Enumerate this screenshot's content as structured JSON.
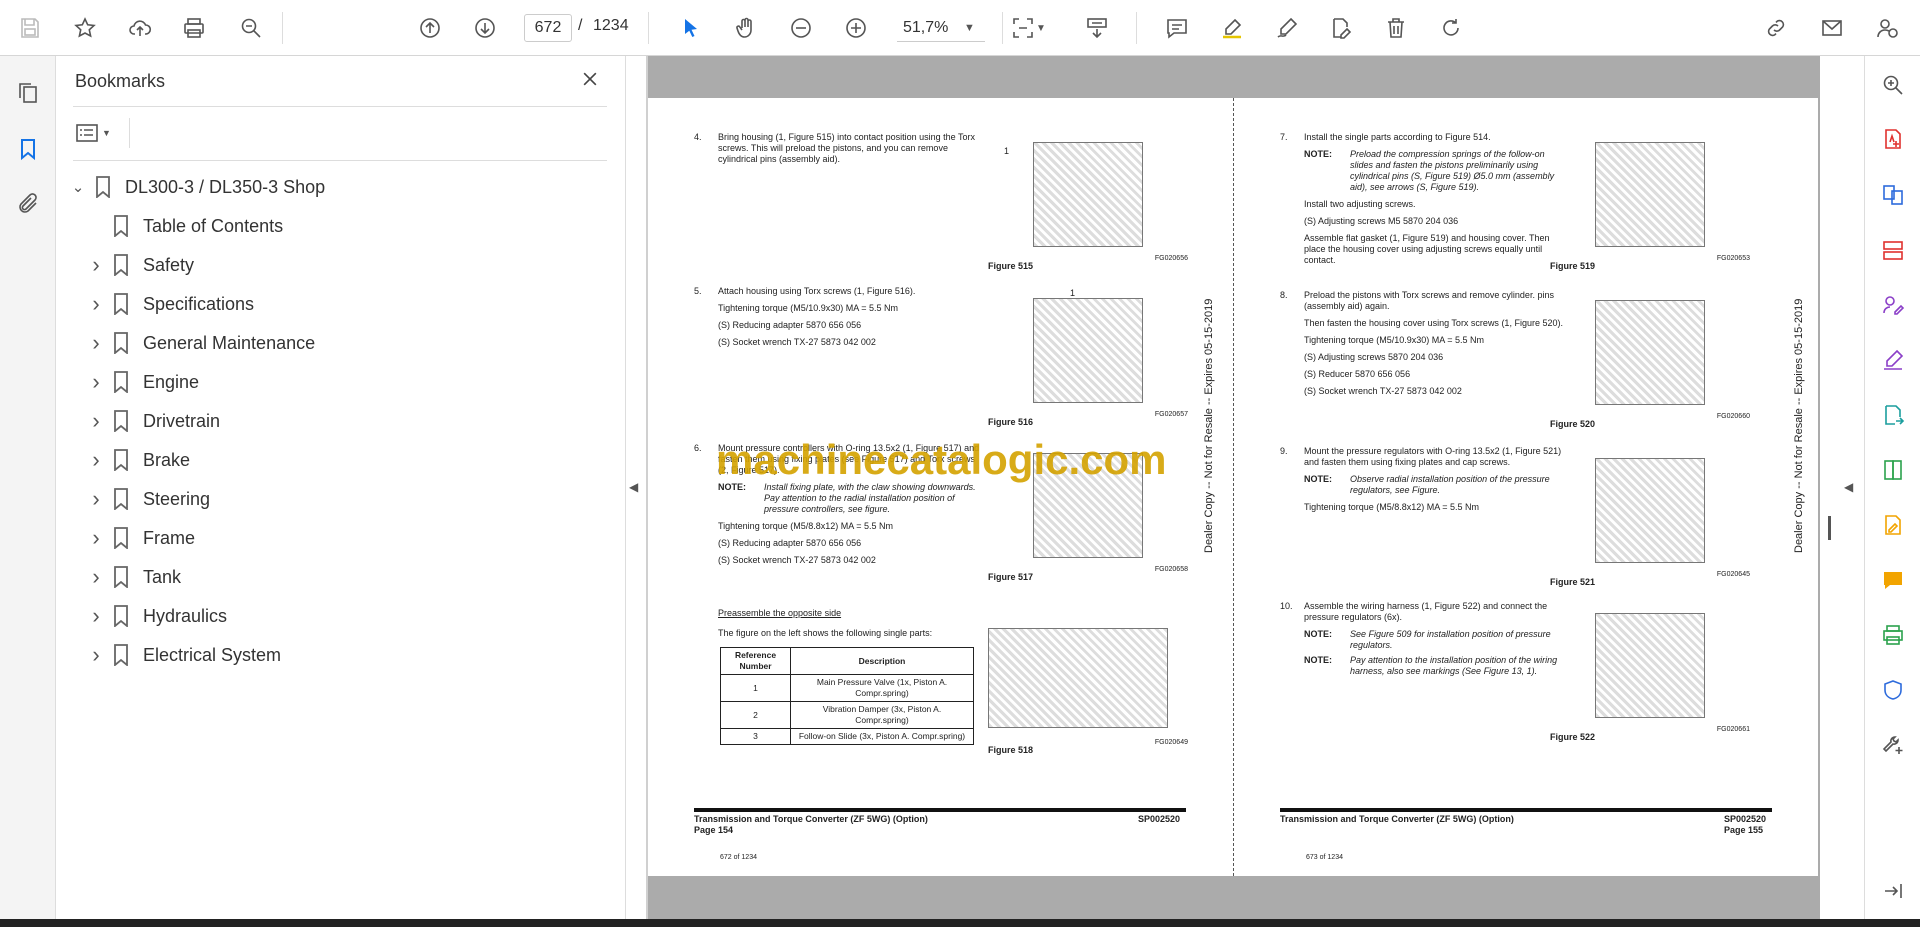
{
  "toolbar": {
    "page_current": "672",
    "page_sep": "/",
    "page_total": "1234",
    "zoom": "51,7%"
  },
  "bookmarks": {
    "title": "Bookmarks",
    "root": "DL300-3 / DL350-3 Shop",
    "items": [
      {
        "label": "Table of Contents",
        "expandable": false
      },
      {
        "label": "Safety",
        "expandable": true
      },
      {
        "label": "Specifications",
        "expandable": true
      },
      {
        "label": "General Maintenance",
        "expandable": true
      },
      {
        "label": "Engine",
        "expandable": true
      },
      {
        "label": "Drivetrain",
        "expandable": true
      },
      {
        "label": "Brake",
        "expandable": true
      },
      {
        "label": "Steering",
        "expandable": true
      },
      {
        "label": "Frame",
        "expandable": true
      },
      {
        "label": "Tank",
        "expandable": true
      },
      {
        "label": "Hydraulics",
        "expandable": true
      },
      {
        "label": "Electrical System",
        "expandable": true
      }
    ]
  },
  "watermark": "machinecatalogic.com",
  "left_page": {
    "step4": {
      "num": "4.",
      "text": "Bring housing (1, Figure 515) into contact position using the Torx screws. This will preload the pistons, and you can remove cylindrical pins (assembly aid)."
    },
    "fig515": {
      "caption": "Figure 515",
      "code": "FG020656",
      "label": "1"
    },
    "step5": {
      "num": "5.",
      "text": "Attach housing using Torx screws (1, Figure 516).",
      "torque": "Tightening torque (M5/10.9x30) MA = 5.5 Nm",
      "tool1": "(S) Reducing adapter 5870 656 056",
      "tool2": "(S) Socket wrench TX-27 5873 042 002"
    },
    "fig516": {
      "caption": "Figure 516",
      "code": "FG020657",
      "label": "1"
    },
    "step6": {
      "num": "6.",
      "text": "Mount pressure controllers with O-ring 13.5x2 (1, Figure 517) and fasten them using fixing plates (see Figure 517) and Torx screws (2, Figure 517).",
      "note_label": "NOTE:",
      "note1": "Install fixing plate, with the claw showing downwards.",
      "note2": "Pay attention to the radial installation position of pressure controllers, see figure.",
      "torque": "Tightening torque (M5/8.8x12) MA = 5.5 Nm",
      "tool1": "(S) Reducing adapter 5870 656 056",
      "tool2": "(S) Socket wrench TX-27 5873 042 002"
    },
    "fig517": {
      "caption": "Figure 517",
      "code": "FG020658"
    },
    "preassemble": "Preassemble the opposite side",
    "preassemble_text": "The figure on the left shows the following single parts:",
    "table": {
      "headers": [
        "Reference Number",
        "Description"
      ],
      "rows": [
        [
          "1",
          "Main Pressure Valve (1x, Piston A. Compr.spring)"
        ],
        [
          "2",
          "Vibration Damper (3x, Piston A. Compr.spring)"
        ],
        [
          "3",
          "Follow-on Slide (3x, Piston A. Compr.spring)"
        ]
      ]
    },
    "fig518": {
      "caption": "Figure 518",
      "code": "FG020649"
    },
    "footer_title": "Transmission and Torque Converter (ZF 5WG) (Option)",
    "footer_page": "Page 154",
    "footer_code": "SP002520",
    "pageof": "672 of 1234",
    "vertical": "Dealer Copy -- Not for Resale -- Expires 05-15-2019"
  },
  "right_page": {
    "step7": {
      "num": "7.",
      "text": "Install the single parts according to Figure 514.",
      "note_label": "NOTE:",
      "note": "Preload the compression springs of the follow-on slides and fasten the pistons preliminarily using cylindrical pins (S, Figure 519) Ø5.0 mm (assembly aid), see arrows (S, Figure 519).",
      "p1": "Install two adjusting screws.",
      "p2": "(S) Adjusting screws M5 5870 204 036",
      "p3": "Assemble flat gasket (1, Figure 519) and housing cover. Then place the housing cover using adjusting screws equally until contact."
    },
    "fig519": {
      "caption": "Figure 519",
      "code": "FG020653"
    },
    "step8": {
      "num": "8.",
      "text": "Preload the pistons with Torx screws and remove cylinder. pins (assembly aid) again.",
      "p1": "Then fasten the housing cover using Torx screws (1, Figure 520).",
      "torque": "Tightening torque (M5/10.9x30) MA = 5.5 Nm",
      "tool1": "(S) Adjusting screws 5870 204 036",
      "tool2": "(S) Reducer 5870 656 056",
      "tool3": "(S) Socket wrench TX-27 5873 042 002"
    },
    "fig520": {
      "caption": "Figure 520",
      "code": "FG020660"
    },
    "step9": {
      "num": "9.",
      "text": "Mount the pressure regulators with O-ring 13.5x2 (1, Figure 521) and fasten them using fixing plates and cap screws.",
      "note_label": "NOTE:",
      "note": "Observe radial installation position of the pressure regulators, see Figure.",
      "torque": "Tightening torque (M5/8.8x12) MA = 5.5 Nm"
    },
    "fig521": {
      "caption": "Figure 521",
      "code": "FG020645"
    },
    "step10": {
      "num": "10.",
      "text": "Assemble the wiring harness (1, Figure 522) and connect the pressure regulators (6x).",
      "note_label": "NOTE:",
      "note1": "See Figure 509 for installation position of pressure regulators.",
      "note2": "Pay attention to the installation position of the wiring harness, also see markings (See Figure 13, 1)."
    },
    "fig522": {
      "caption": "Figure 522",
      "code": "FG020661"
    },
    "footer_title": "Transmission and Torque Converter (ZF 5WG) (Option)",
    "footer_page": "Page 155",
    "footer_code": "SP002520",
    "pageof": "673 of 1234",
    "vertical": "Dealer Copy -- Not for Resale -- Expires 05-15-2019"
  }
}
